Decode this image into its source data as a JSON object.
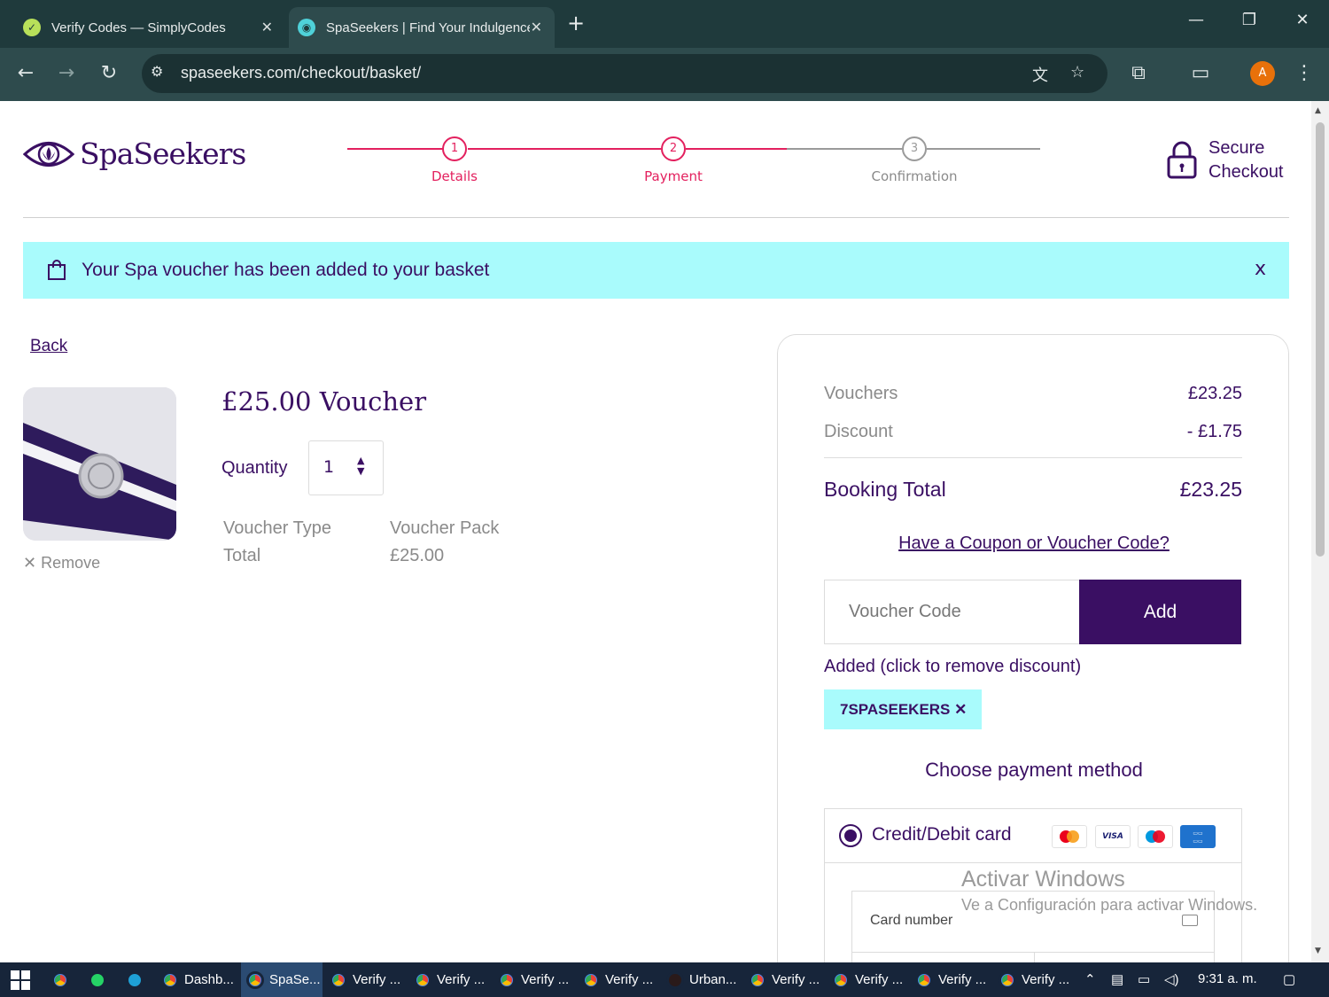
{
  "browser": {
    "tabs": [
      {
        "title": "Verify Codes — SimplyCodes"
      },
      {
        "title": "SpaSeekers | Find Your Indulgence"
      }
    ],
    "url": "spaseekers.com/checkout/basket/",
    "profile_initial": "A"
  },
  "header": {
    "brand": "SpaSeekers",
    "steps": [
      {
        "num": "1",
        "label": "Details",
        "state": "done"
      },
      {
        "num": "2",
        "label": "Payment",
        "state": "current"
      },
      {
        "num": "3",
        "label": "Confirmation",
        "state": "pending"
      }
    ],
    "secure_line1": "Secure",
    "secure_line2": "Checkout"
  },
  "notice": {
    "message": "Your Spa voucher has been added to your basket",
    "close": "x"
  },
  "basket": {
    "back_label": "Back",
    "item_title": "£25.00 Voucher",
    "quantity_label": "Quantity",
    "quantity_value": "1",
    "remove_label": "Remove",
    "voucher_type_label": "Voucher Type",
    "voucher_type_value": "Voucher Pack",
    "total_label": "Total",
    "total_value": "£25.00"
  },
  "summary": {
    "vouchers_label": "Vouchers",
    "vouchers_value": "£23.25",
    "discount_label": "Discount",
    "discount_value": "- £1.75",
    "booking_total_label": "Booking Total",
    "booking_total_value": "£23.25",
    "coupon_link": "Have a Coupon or Voucher Code?",
    "voucher_placeholder": "Voucher Code",
    "add_label": "Add",
    "added_text": "Added (click to remove discount)",
    "applied_code": "7SPASEEKERS",
    "choose_payment": "Choose payment method",
    "payment_option": "Credit/Debit card",
    "card_number_label": "Card number"
  },
  "watermark": {
    "line1": "Activar Windows",
    "line2": "Ve a Configuración para activar Windows."
  },
  "taskbar": {
    "items": [
      "Dashb...",
      "SpaSe...",
      "Verify ...",
      "Verify ...",
      "Verify ...",
      "Verify ...",
      "Urban...",
      "Verify ...",
      "Verify ...",
      "Verify ...",
      "Verify ..."
    ],
    "time": "9:31 a. m."
  },
  "colors": {
    "brand_purple": "#3a0f63",
    "accent_pink": "#e3205e",
    "notice_cyan": "#a9fbfc"
  }
}
